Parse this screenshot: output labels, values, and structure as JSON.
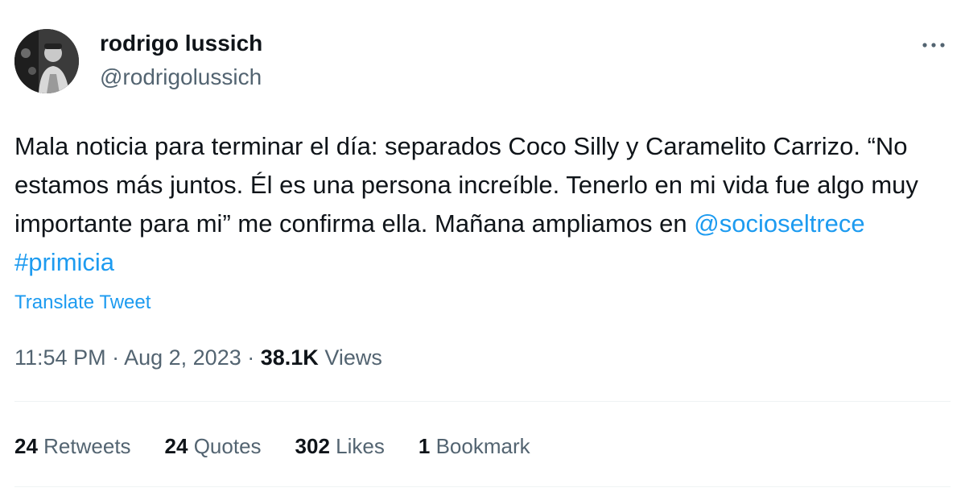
{
  "author": {
    "display_name": "rodrigo lussich",
    "handle": "@rodrigolussich"
  },
  "tweet": {
    "text_parts": [
      "Mala noticia para terminar el día: separados Coco Silly y Caramelito Carrizo. “No estamos más juntos. Él es una persona increíble. Tenerlo en mi vida fue algo muy importante para mi” me confirma ella. Mañana ampliamos en ",
      "@socioseltrece",
      " ",
      "#primicia"
    ],
    "translate_label": "Translate Tweet"
  },
  "meta": {
    "time": "11:54 PM",
    "separator": " · ",
    "date": "Aug 2, 2023",
    "views_count": "38.1K",
    "views_label": "Views"
  },
  "stats": {
    "retweets_count": "24",
    "retweets_label": "Retweets",
    "quotes_count": "24",
    "quotes_label": "Quotes",
    "likes_count": "302",
    "likes_label": "Likes",
    "bookmarks_count": "1",
    "bookmarks_label": "Bookmark"
  },
  "icons": {
    "more": "more-horizontal-icon"
  },
  "colors": {
    "text": "#0f1419",
    "secondary": "#536471",
    "link": "#1d9bf0",
    "divider": "#eff3f4"
  }
}
